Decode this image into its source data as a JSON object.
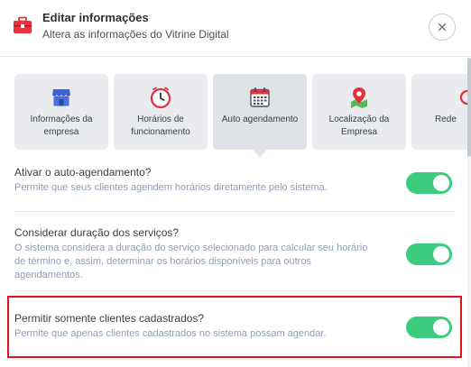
{
  "header": {
    "title": "Editar informações",
    "subtitle": "Altera as informações do Vitrine Digital",
    "icon": "briefcase-icon",
    "close_icon": "close-icon"
  },
  "tabs": [
    {
      "label": "Informações da empresa",
      "icon": "store-icon"
    },
    {
      "label": "Horários de funcionamento",
      "icon": "clock-icon"
    },
    {
      "label": "Auto agendamento",
      "icon": "calendar-icon",
      "active": true
    },
    {
      "label": "Localização da Empresa",
      "icon": "map-pin-icon"
    },
    {
      "label": "Rede",
      "icon": "social-network-icon"
    }
  ],
  "settings": [
    {
      "title": "Ativar o auto-agendamento?",
      "description": "Permite que seus clientes agendem horários diretamente pelo sistema.",
      "enabled": true
    },
    {
      "title": "Considerar duração dos serviços?",
      "description": "O sistema considera a duração do serviço selecionado para calcular seu horário de término e, assim, determinar os horários disponíveis para outros agendamentos.",
      "enabled": true
    },
    {
      "title": "Permitir somente clientes cadastrados?",
      "description": "Permite que apenas clientes cadastrados no sistema possam agendar.",
      "enabled": true
    }
  ],
  "colors": {
    "toggle_on": "#3ccb7f",
    "highlight_border": "#e0141e",
    "description_text": "#8f9cb6",
    "tab_background": "#e9ebef"
  }
}
